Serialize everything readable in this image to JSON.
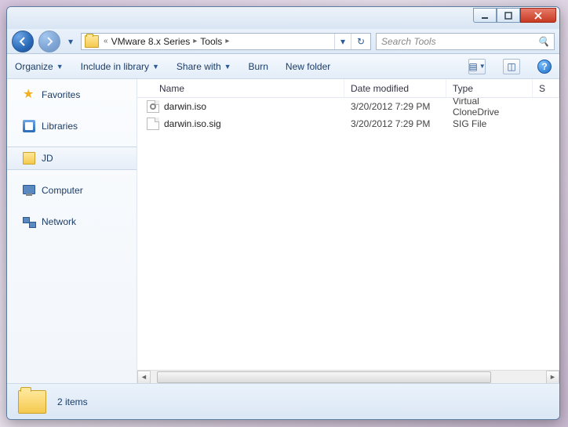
{
  "breadcrumb": {
    "prefix": "«",
    "parent": "VMware 8.x Series",
    "current": "Tools"
  },
  "search": {
    "placeholder": "Search Tools"
  },
  "toolbar": {
    "organize": "Organize",
    "include": "Include in library",
    "share": "Share with",
    "burn": "Burn",
    "newfolder": "New folder"
  },
  "sidebar": {
    "favorites": "Favorites",
    "libraries": "Libraries",
    "user": "JD",
    "computer": "Computer",
    "network": "Network"
  },
  "columns": {
    "name": "Name",
    "date": "Date modified",
    "type": "Type",
    "size": "S"
  },
  "files": [
    {
      "name": "darwin.iso",
      "date": "3/20/2012 7:29 PM",
      "type": "Virtual CloneDrive",
      "icon": "iso"
    },
    {
      "name": "darwin.iso.sig",
      "date": "3/20/2012 7:29 PM",
      "type": "SIG File",
      "icon": "file"
    }
  ],
  "status": {
    "count": "2 items"
  },
  "help": "?"
}
